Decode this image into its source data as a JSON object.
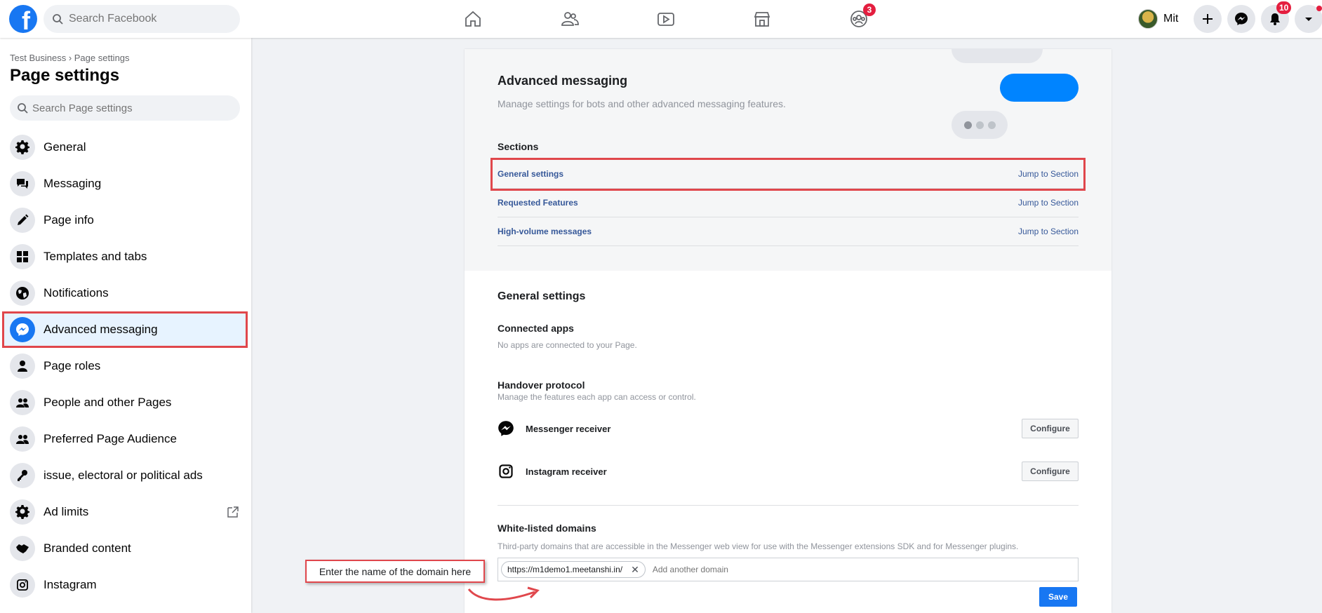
{
  "topbar": {
    "logo_letter": "f",
    "search_placeholder": "Search Facebook",
    "groups_badge": "3",
    "user_name": "Mit",
    "notifications_badge": "10"
  },
  "sidebar": {
    "breadcrumb": "Test Business › Page settings",
    "title": "Page settings",
    "search_placeholder": "Search Page settings",
    "items": [
      {
        "label": "General"
      },
      {
        "label": "Messaging"
      },
      {
        "label": "Page info"
      },
      {
        "label": "Templates and tabs"
      },
      {
        "label": "Notifications"
      },
      {
        "label": "Advanced messaging"
      },
      {
        "label": "Page roles"
      },
      {
        "label": "People and other Pages"
      },
      {
        "label": "Preferred Page Audience"
      },
      {
        "label": "issue, electoral or political ads"
      },
      {
        "label": "Ad limits"
      },
      {
        "label": "Branded content"
      },
      {
        "label": "Instagram"
      }
    ]
  },
  "main": {
    "title": "Advanced messaging",
    "description": "Manage settings for bots and other advanced messaging features.",
    "sections_heading": "Sections",
    "jump_label": "Jump to Section",
    "sections": [
      {
        "name": "General settings"
      },
      {
        "name": "Requested Features"
      },
      {
        "name": "High-volume messages"
      }
    ],
    "general_settings": {
      "title": "General settings",
      "connected_apps_heading": "Connected apps",
      "connected_apps_desc": "No apps are connected to your Page.",
      "handover_heading": "Handover protocol",
      "handover_desc": "Manage the features each app can access or control.",
      "messenger_receiver": "Messenger receiver",
      "instagram_receiver": "Instagram receiver",
      "configure_label": "Configure",
      "whitelist_heading": "White-listed domains",
      "whitelist_desc": "Third-party domains that are accessible in the Messenger web view for use with the Messenger extensions SDK and for Messenger plugins.",
      "domain_chip": "https://m1demo1.meetanshi.in/",
      "domain_placeholder": "Add another domain",
      "save_label": "Save"
    }
  },
  "annotation": {
    "text": "Enter the name of the domain here"
  },
  "colors": {
    "brand": "#1877f2",
    "highlight": "#e0474c",
    "link": "#365899",
    "badge": "#e41e3f"
  }
}
